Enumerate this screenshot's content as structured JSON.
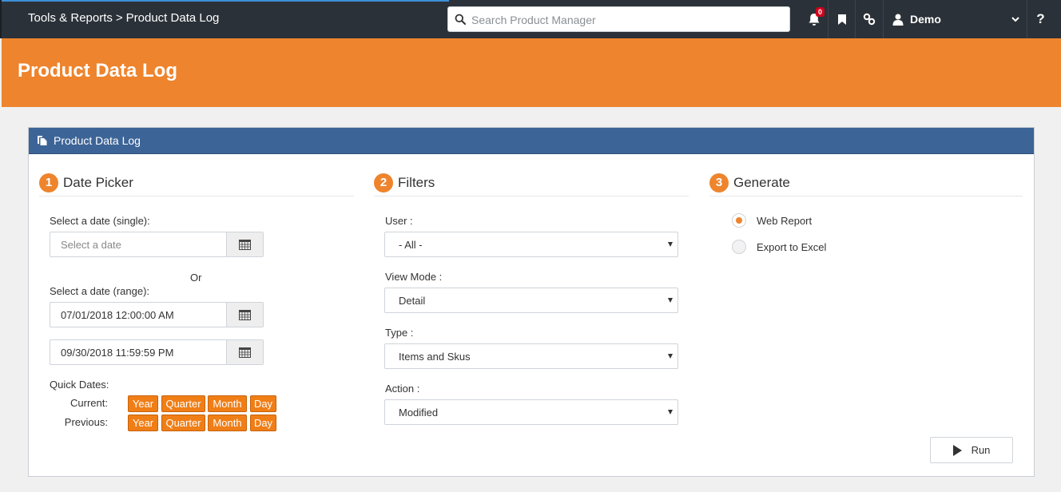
{
  "topbar": {
    "breadcrumb": {
      "parent": "Tools & Reports",
      "separator": ">",
      "current": "Product Data Log"
    },
    "search_placeholder": "Search Product Manager",
    "notifications_count": "0",
    "user_name": "Demo",
    "help_label": "?"
  },
  "page_title": "Product Data Log",
  "panel": {
    "title": "Product Data Log",
    "date_picker": {
      "step": "1",
      "title": "Date Picker",
      "single_label": "Select a date (single):",
      "single_placeholder": "Select a date",
      "or_label": "Or",
      "range_label": "Select a date (range):",
      "range_start": "07/01/2018 12:00:00 AM",
      "range_end": "09/30/2018 11:59:59 PM",
      "quick_dates_label": "Quick Dates:",
      "current_label": "Current:",
      "previous_label": "Previous:",
      "quick_buttons": [
        "Year",
        "Quarter",
        "Month",
        "Day"
      ]
    },
    "filters": {
      "step": "2",
      "title": "Filters",
      "user_label": "User :",
      "user_value": "- All -",
      "view_mode_label": "View Mode :",
      "view_mode_value": "Detail",
      "type_label": "Type :",
      "type_value": "Items and Skus",
      "action_label": "Action :",
      "action_value": "Modified"
    },
    "generate": {
      "step": "3",
      "title": "Generate",
      "option_web": "Web Report",
      "option_excel": "Export to Excel",
      "selected": "Web Report",
      "run_label": "Run"
    }
  },
  "colors": {
    "accent": "#ee842d",
    "panel_header": "#3c6497",
    "topbar": "#2b3138"
  }
}
